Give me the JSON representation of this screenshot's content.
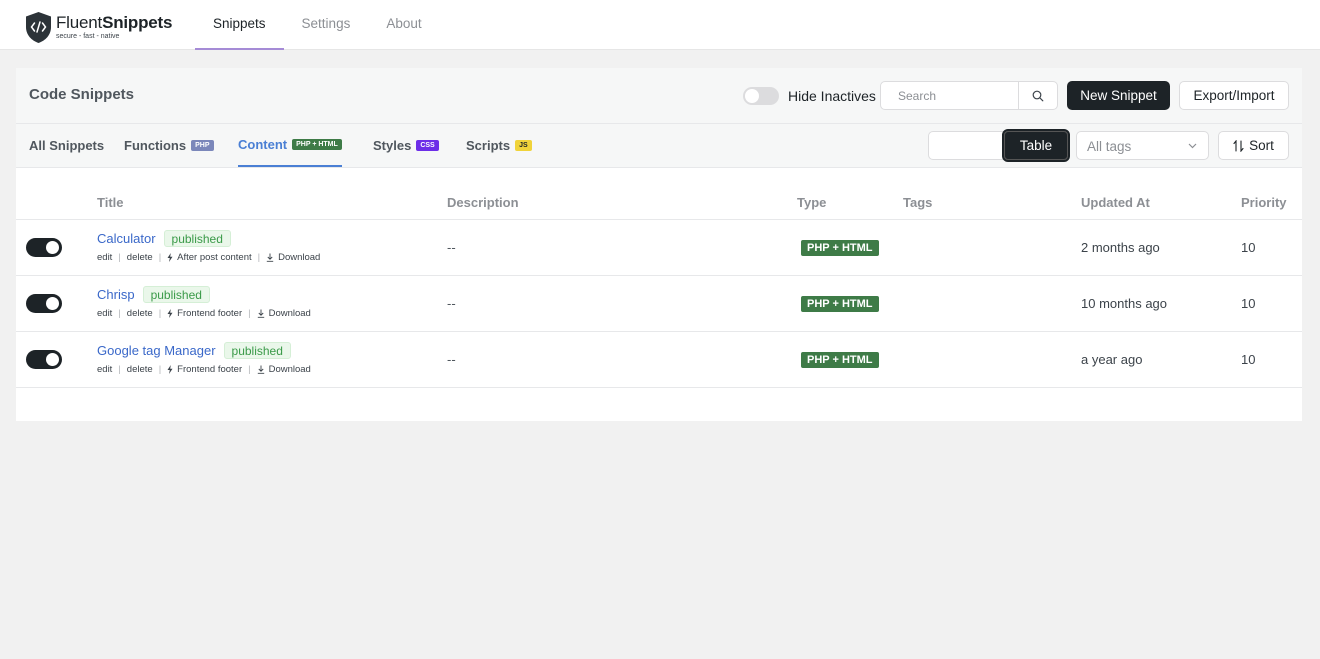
{
  "brand": {
    "name_light": "Fluent",
    "name_bold": "Snippets",
    "tagline": "secure - fast - native"
  },
  "topnav": [
    {
      "label": "Snippets",
      "active": true
    },
    {
      "label": "Settings",
      "active": false
    },
    {
      "label": "About",
      "active": false
    }
  ],
  "header": {
    "title": "Code Snippets",
    "hide_inactives_label": "Hide Inactives",
    "search_placeholder": "Search",
    "new_snippet_label": "New Snippet",
    "export_import_label": "Export/Import"
  },
  "tabs": [
    {
      "label": "All Snippets",
      "badge": ""
    },
    {
      "label": "Functions",
      "badge": "PHP"
    },
    {
      "label": "Content",
      "badge": "PHP + HTML",
      "active": true
    },
    {
      "label": "Styles",
      "badge": "CSS"
    },
    {
      "label": "Scripts",
      "badge": "JS"
    }
  ],
  "toolbar": {
    "view_table_label": "Table",
    "tags_placeholder": "All tags",
    "sort_label": "Sort"
  },
  "table": {
    "columns": {
      "title": "Title",
      "description": "Description",
      "type": "Type",
      "tags": "Tags",
      "updated": "Updated At",
      "priority": "Priority"
    },
    "action_edit": "edit",
    "action_delete": "delete",
    "action_download": "Download",
    "rows": [
      {
        "title": "Calculator",
        "status": "published",
        "location": "After post content",
        "description": "--",
        "type": "PHP + HTML",
        "tags": "",
        "updated": "2 months ago",
        "priority": "10",
        "enabled": true
      },
      {
        "title": "Chrisp",
        "status": "published",
        "location": "Frontend footer",
        "description": "--",
        "type": "PHP + HTML",
        "tags": "",
        "updated": "10 months ago",
        "priority": "10",
        "enabled": true
      },
      {
        "title": "Google tag Manager",
        "status": "published",
        "location": "Frontend footer",
        "description": "--",
        "type": "PHP + HTML",
        "tags": "",
        "updated": "a year ago",
        "priority": "10",
        "enabled": true
      }
    ]
  },
  "colors": {
    "accent": "#4a7fd4",
    "dark": "#1d2327",
    "type_badge": "#3e7b47",
    "status_green": "#3a9a48"
  },
  "icons": {
    "logo": "code-shield-icon",
    "search": "search-icon",
    "chevron": "chevron-down-icon",
    "sort": "sort-arrows-icon",
    "trigger": "bolt-icon",
    "download": "download-icon"
  }
}
